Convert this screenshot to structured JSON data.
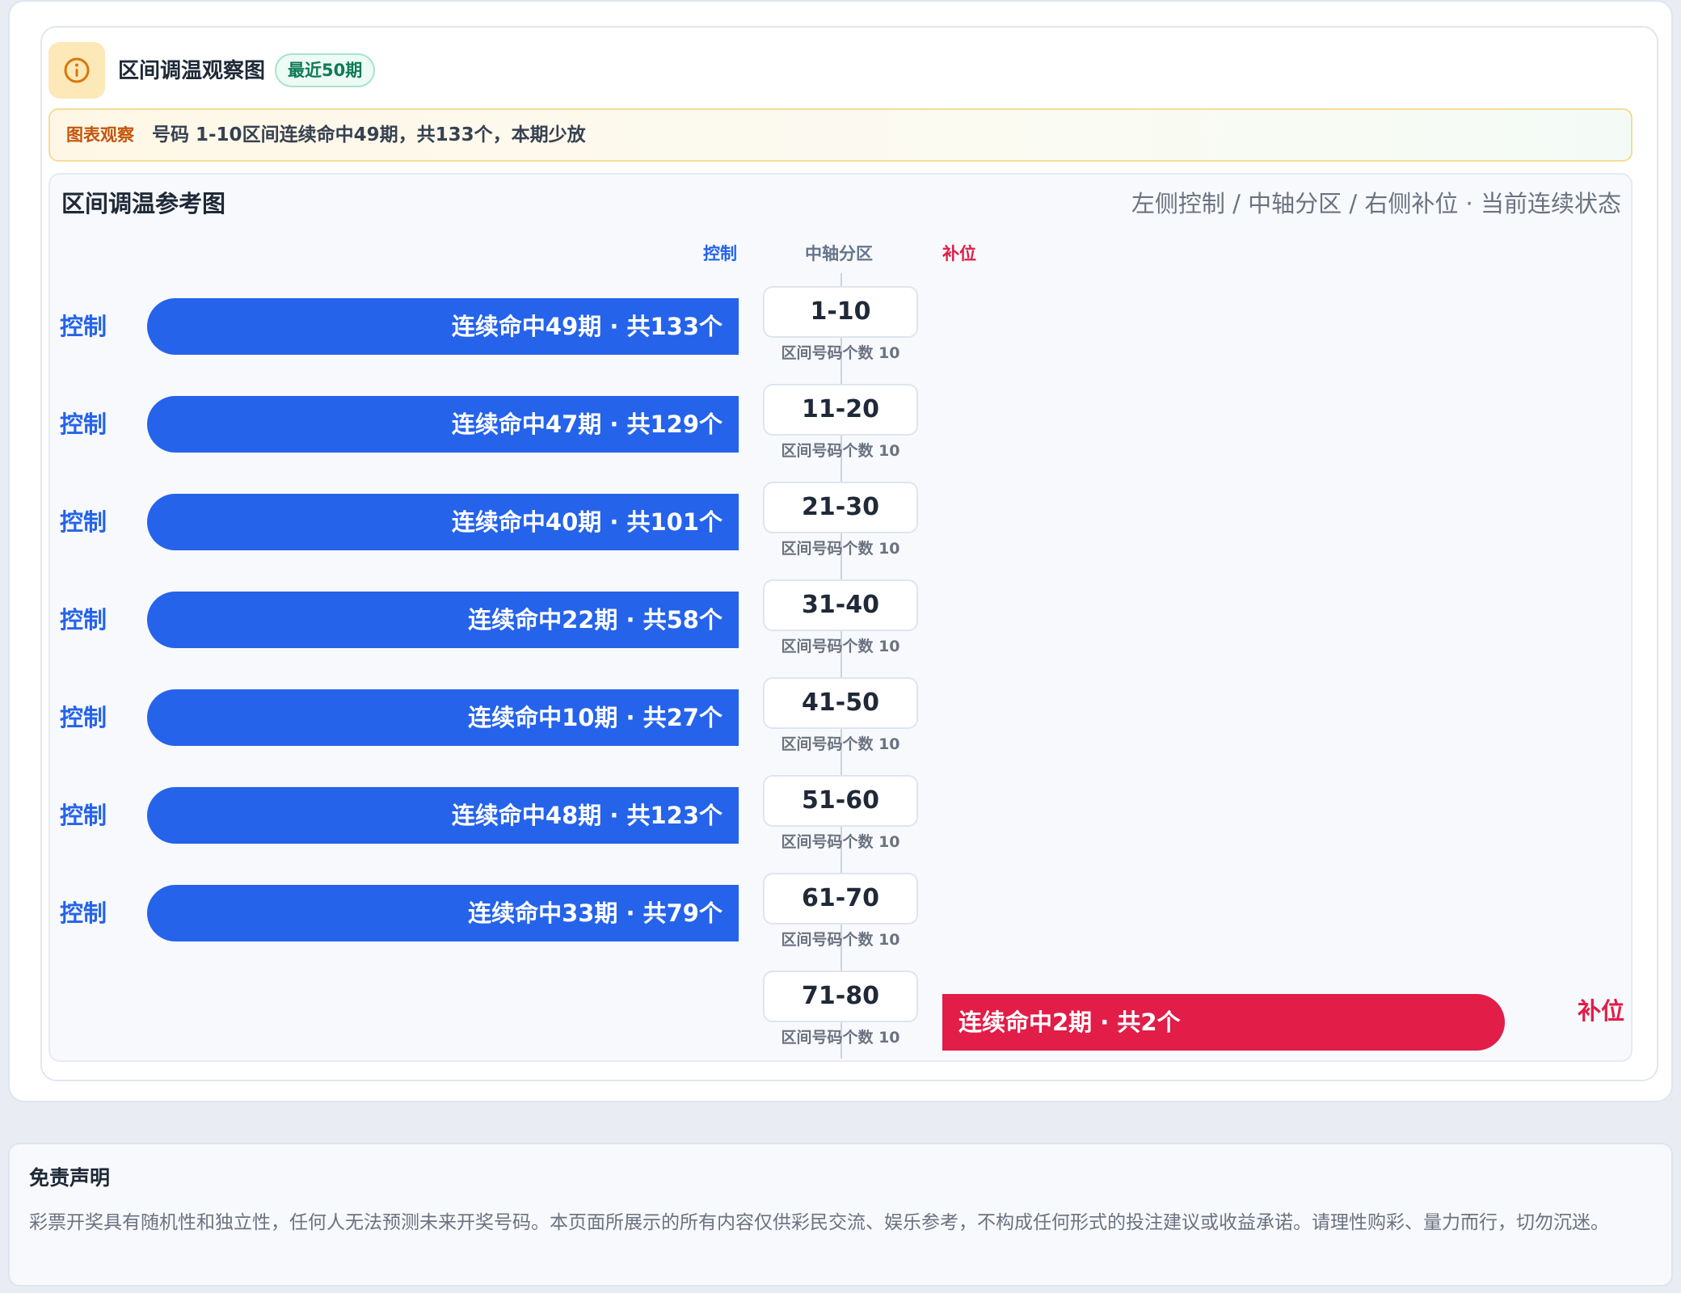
{
  "header": {
    "title": "区间调温观察图",
    "period_badge": "最近50期",
    "info_icon": "info-icon"
  },
  "observation": {
    "label": "图表观察",
    "text": "号码 1-10区间连续命中49期，共133个，本期少放"
  },
  "chart_data": {
    "type": "bar",
    "title": "区间调温参考图",
    "subtitle": "左侧控制 / 中轴分区 / 右侧补位 · 当前连续状态",
    "column_headers": {
      "left": "控制",
      "middle": "中轴分区",
      "right": "补位"
    },
    "count_label": "区间号码个数 10",
    "categories": [
      "1-10",
      "11-20",
      "21-30",
      "31-40",
      "41-50",
      "51-60",
      "61-70",
      "71-80"
    ],
    "rows": [
      {
        "range": "1-10",
        "side": "控制",
        "label": "连续命中49期 · 共133个",
        "streak": 49,
        "total": 133
      },
      {
        "range": "11-20",
        "side": "控制",
        "label": "连续命中47期 · 共129个",
        "streak": 47,
        "total": 129
      },
      {
        "range": "21-30",
        "side": "控制",
        "label": "连续命中40期 · 共101个",
        "streak": 40,
        "total": 101
      },
      {
        "range": "31-40",
        "side": "控制",
        "label": "连续命中22期 · 共58个",
        "streak": 22,
        "total": 58
      },
      {
        "range": "41-50",
        "side": "控制",
        "label": "连续命中10期 · 共27个",
        "streak": 10,
        "total": 27
      },
      {
        "range": "51-60",
        "side": "控制",
        "label": "连续命中48期 · 共123个",
        "streak": 48,
        "total": 123
      },
      {
        "range": "61-70",
        "side": "控制",
        "label": "连续命中33期 · 共79个",
        "streak": 33,
        "total": 79
      },
      {
        "range": "71-80",
        "side": "补位",
        "label": "连续命中2期 · 共2个",
        "streak": 2,
        "total": 2
      }
    ],
    "colors": {
      "control": "#2563eb",
      "fill": "#e11d48"
    }
  },
  "disclaimer": {
    "title": "免责声明",
    "text": "彩票开奖具有随机性和独立性，任何人无法预测未来开奖号码。本页面所展示的所有内容仅供彩民交流、娱乐参考，不构成任何形式的投注建议或收益承诺。请理性购彩、量力而行，切勿沉迷。"
  }
}
